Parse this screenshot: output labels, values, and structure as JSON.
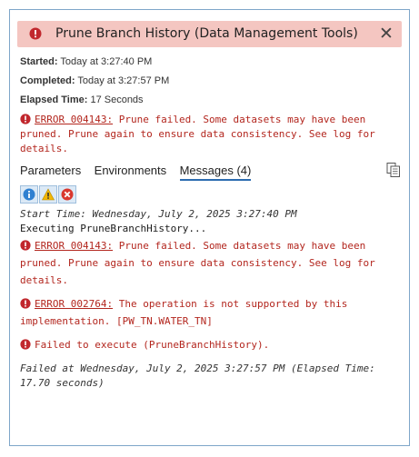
{
  "window": {
    "title": "Prune Branch History (Data Management Tools)",
    "close_glyph": "✕"
  },
  "meta": {
    "started_label": "Started:",
    "started_value": "Today at 3:27:40 PM",
    "completed_label": "Completed:",
    "completed_value": "Today at 3:27:57 PM",
    "elapsed_label": "Elapsed Time:",
    "elapsed_value": "17 Seconds"
  },
  "summary_error": {
    "code": "ERROR 004143:",
    "line1": " Prune failed. Some datasets may have been",
    "line2": "pruned. Prune again to ensure data consistency. See log for",
    "line3": "details."
  },
  "tabs": [
    {
      "label": "Parameters"
    },
    {
      "label": "Environments"
    },
    {
      "label": "Messages (4)"
    }
  ],
  "messages": {
    "start_time": "Start Time: Wednesday, July 2, 2025 3:27:40 PM",
    "executing": "Executing PruneBranchHistory...",
    "error1_code": "ERROR 004143:",
    "error1_line1": " Prune failed. Some datasets may have been",
    "error1_line2": "pruned. Prune again to ensure data consistency. See log for",
    "error1_line3": "details.",
    "error2_code": "ERROR 002764:",
    "error2_line1": " The operation is not supported by this",
    "error2_line2": "implementation. [PW_TN.WATER_TN]",
    "failed_exec": "Failed to execute (PruneBranchHistory).",
    "failed_at_line1": "Failed at Wednesday, July 2, 2025 3:27:57 PM (Elapsed Time:",
    "failed_at_line2": "17.70 seconds)"
  },
  "icons": {
    "header": "error-icon",
    "close": "close-icon",
    "copy": "copy-icon",
    "filter_info": "info-icon",
    "filter_warning": "warning-icon",
    "filter_error": "error-icon"
  },
  "colors": {
    "header_bg": "#f4c6c1",
    "error_red": "#b3261e",
    "panel_border": "#7ea6c9",
    "tab_underline": "#2b6cb0"
  }
}
